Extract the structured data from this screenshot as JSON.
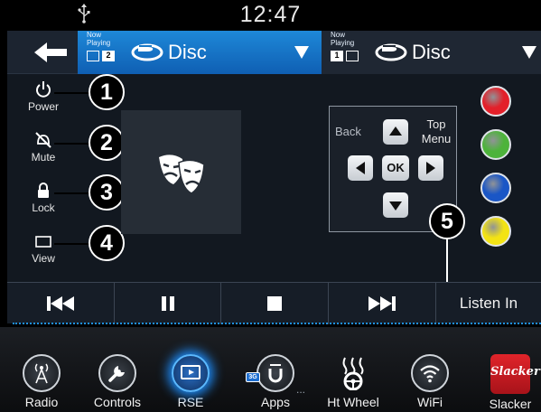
{
  "status_bar": {
    "time": "12:47",
    "usb_icon": "usb-icon"
  },
  "header": {
    "back_icon": "back-arrow-icon",
    "sources": [
      {
        "now_playing": "Now Playing",
        "screen_boxes": [
          "",
          "2"
        ],
        "highlighted_box": 2,
        "disc_icon": "blu-ray-disc-icon",
        "label": "Disc",
        "selected": true
      },
      {
        "now_playing": "Now Playing",
        "screen_boxes": [
          "1",
          ""
        ],
        "highlighted_box": 1,
        "disc_icon": "blu-ray-disc-icon",
        "label": "Disc",
        "selected": false
      }
    ]
  },
  "side_controls": [
    {
      "icon": "power-icon",
      "label": "Power",
      "callout": "1"
    },
    {
      "icon": "mute-icon",
      "label": "Mute",
      "callout": "2"
    },
    {
      "icon": "lock-icon",
      "label": "Lock",
      "callout": "3"
    },
    {
      "icon": "view-icon",
      "label": "View",
      "callout": "4"
    }
  ],
  "media_art": {
    "icon": "theater-masks-icon"
  },
  "navigation_pad": {
    "back_label": "Back",
    "top_menu_label": "Top Menu",
    "ok_label": "OK",
    "arrows": [
      "up-arrow-icon",
      "down-arrow-icon",
      "left-arrow-icon",
      "right-arrow-icon"
    ]
  },
  "color_buttons": [
    "#e3202a",
    "#4db33b",
    "#1a56c6",
    "#f3e314"
  ],
  "transport": {
    "buttons": [
      "previous-track-icon",
      "pause-icon",
      "stop-icon",
      "next-track-icon"
    ],
    "listen_in_label": "Listen In",
    "listen_in_callout": "5"
  },
  "apps": [
    {
      "icon": "radio-icon",
      "label": "Radio"
    },
    {
      "icon": "controls-icon",
      "label": "Controls"
    },
    {
      "icon": "rse-icon",
      "label": "RSE",
      "active": true
    },
    {
      "icon": "uconnect-apps-icon",
      "label": "Apps",
      "badge": "3G"
    },
    {
      "icon": "heated-wheel-icon",
      "label": "Ht Wheel"
    },
    {
      "icon": "wifi-icon",
      "label": "WiFi"
    },
    {
      "icon": "slacker-icon",
      "label": "Slacker",
      "tile_text": "Slacker"
    }
  ],
  "more_indicator": "...",
  "colors": {
    "accent_blue": "#1e88d8",
    "active_glow": "#1e8fff"
  }
}
